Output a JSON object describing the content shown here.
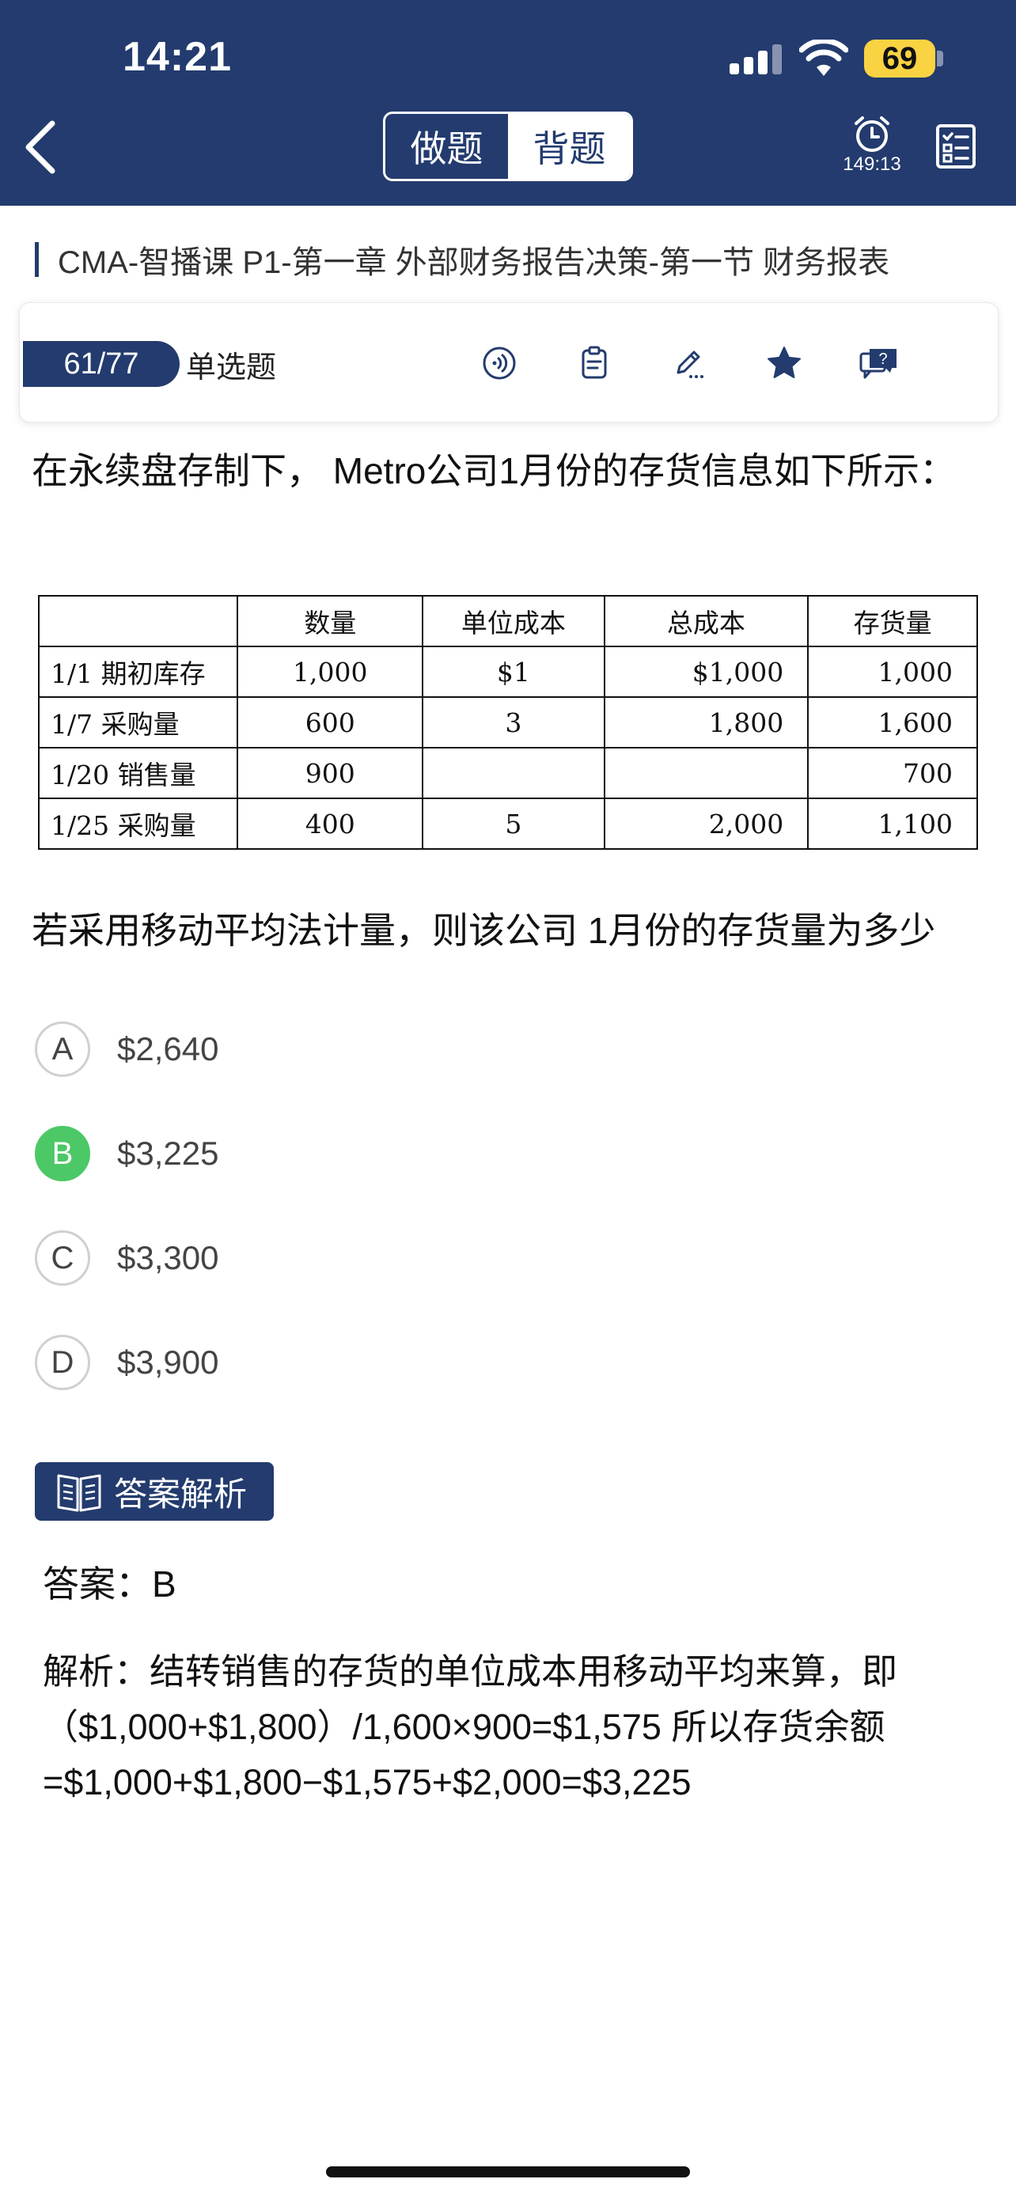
{
  "status_bar": {
    "time": "14:21",
    "battery": "69"
  },
  "header": {
    "mode_tabs": [
      "做题",
      "背题"
    ],
    "active_tab": "背题",
    "timer": "149:13"
  },
  "breadcrumb": "CMA-智播课 P1-第一章 外部财务报告决策-第一节 财务报表",
  "question_info": {
    "progress": "61/77",
    "type": "单选题",
    "tools": [
      "audio-icon",
      "notes-icon",
      "edit-icon",
      "favorite-star-icon",
      "ask-question-icon"
    ]
  },
  "stem": "在永续盘存制下， Metro公司1月份的存货信息如下所示：",
  "inventory_table": {
    "headers": [
      "",
      "数量",
      "单位成本",
      "总成本",
      "存货量"
    ],
    "rows": [
      [
        "1/1 期初库存",
        "1,000",
        "$1",
        "$1,000",
        "1,000"
      ],
      [
        "1/7 采购量",
        "600",
        "3",
        "1,800",
        "1,600"
      ],
      [
        "1/20 销售量",
        "900",
        "",
        "",
        "700"
      ],
      [
        "1/25 采购量",
        "400",
        "5",
        "2,000",
        "1,100"
      ]
    ]
  },
  "question": "若采用移动平均法计量，则该公司 1月份的存货量为多少",
  "options": [
    {
      "letter": "A",
      "text": "$2,640"
    },
    {
      "letter": "B",
      "text": "$3,225"
    },
    {
      "letter": "C",
      "text": "$3,300"
    },
    {
      "letter": "D",
      "text": "$3,900"
    }
  ],
  "correct_option": "B",
  "colors": {
    "header_navy": "#233b6e",
    "correct_green": "#4cc866",
    "battery_yellow": "#f9d342"
  },
  "analysis": {
    "title": "答案解析",
    "answer": "答案：B",
    "explanation_lines": [
      "解析：结转销售的存货的单位成本用移动平均来算，即",
      "（$1,000+$1,800）/1,600×900=$1,575 所以存货余额",
      "=$1,000+$1,800−$1,575+$2,000=$3,225"
    ]
  }
}
